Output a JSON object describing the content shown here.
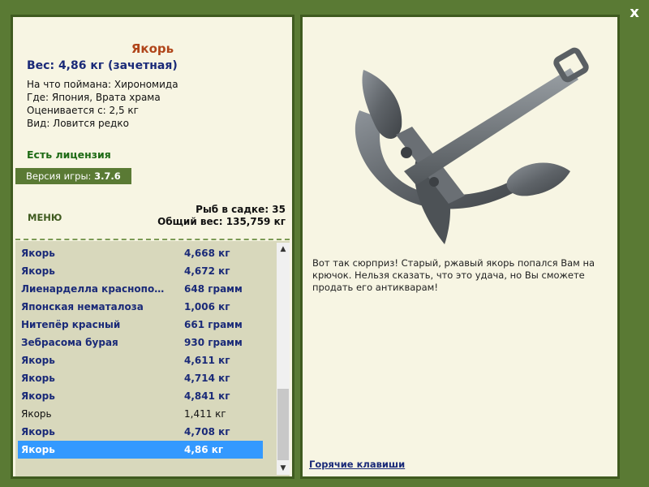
{
  "fish": {
    "title": "Якорь",
    "weight": "Вес: 4,86 кг (зачетная)",
    "caught_on": "На что поймана: Хирономида",
    "location": "Где: Япония, Врата храма",
    "valued_from": "Оценивается с: 2,5 кг",
    "rarity": "Вид: Ловится редко"
  },
  "license": "Есть лицензия",
  "version": {
    "label": "Версия игры: ",
    "value": "3.7.6"
  },
  "menu_label": "МЕНЮ",
  "stats": {
    "fish_in_keepnet": "Рыб в садке: 35",
    "total_weight": "Общий вес: 135,759 кг"
  },
  "catch_list": [
    {
      "name": "Якорь",
      "weight": "4,668 кг",
      "style": "bold"
    },
    {
      "name": "Якорь",
      "weight": "4,672 кг",
      "style": "bold"
    },
    {
      "name": "Лиенарделла краснопо…",
      "weight": "648 грамм",
      "style": "bold"
    },
    {
      "name": "Японская нематалоза",
      "weight": "1,006 кг",
      "style": "bold"
    },
    {
      "name": "Нитепёр красный",
      "weight": "661 грамм",
      "style": "bold"
    },
    {
      "name": "Зебрасома бурая",
      "weight": "930 грамм",
      "style": "bold"
    },
    {
      "name": "Якорь",
      "weight": "4,611 кг",
      "style": "bold"
    },
    {
      "name": "Якорь",
      "weight": "4,714 кг",
      "style": "bold"
    },
    {
      "name": "Якорь",
      "weight": "4,841 кг",
      "style": "bold"
    },
    {
      "name": "Якорь",
      "weight": "1,411 кг",
      "style": "plain"
    },
    {
      "name": "Якорь",
      "weight": "4,708 кг",
      "style": "bold"
    },
    {
      "name": "Якорь",
      "weight": "4,86 кг",
      "style": "selected"
    }
  ],
  "description": "Вот так сюрприз! Старый, ржавый якорь попался Вам на крючок. Нельзя сказать, что это удача, но Вы сможете продать его антикварам!",
  "hotkeys_label": "Горячие клавиши",
  "close_label": "x",
  "icons": {
    "close": "close-icon",
    "anchor": "anchor-image",
    "scroll_up": "scroll-up-icon",
    "scroll_down": "scroll-down-icon"
  },
  "colors": {
    "frame": "#5a7a34",
    "panel": "#f7f5e3",
    "title": "#b0451a",
    "link_blue": "#1a2a78",
    "license_green": "#1d6a14",
    "selected_row": "#3399ff"
  }
}
